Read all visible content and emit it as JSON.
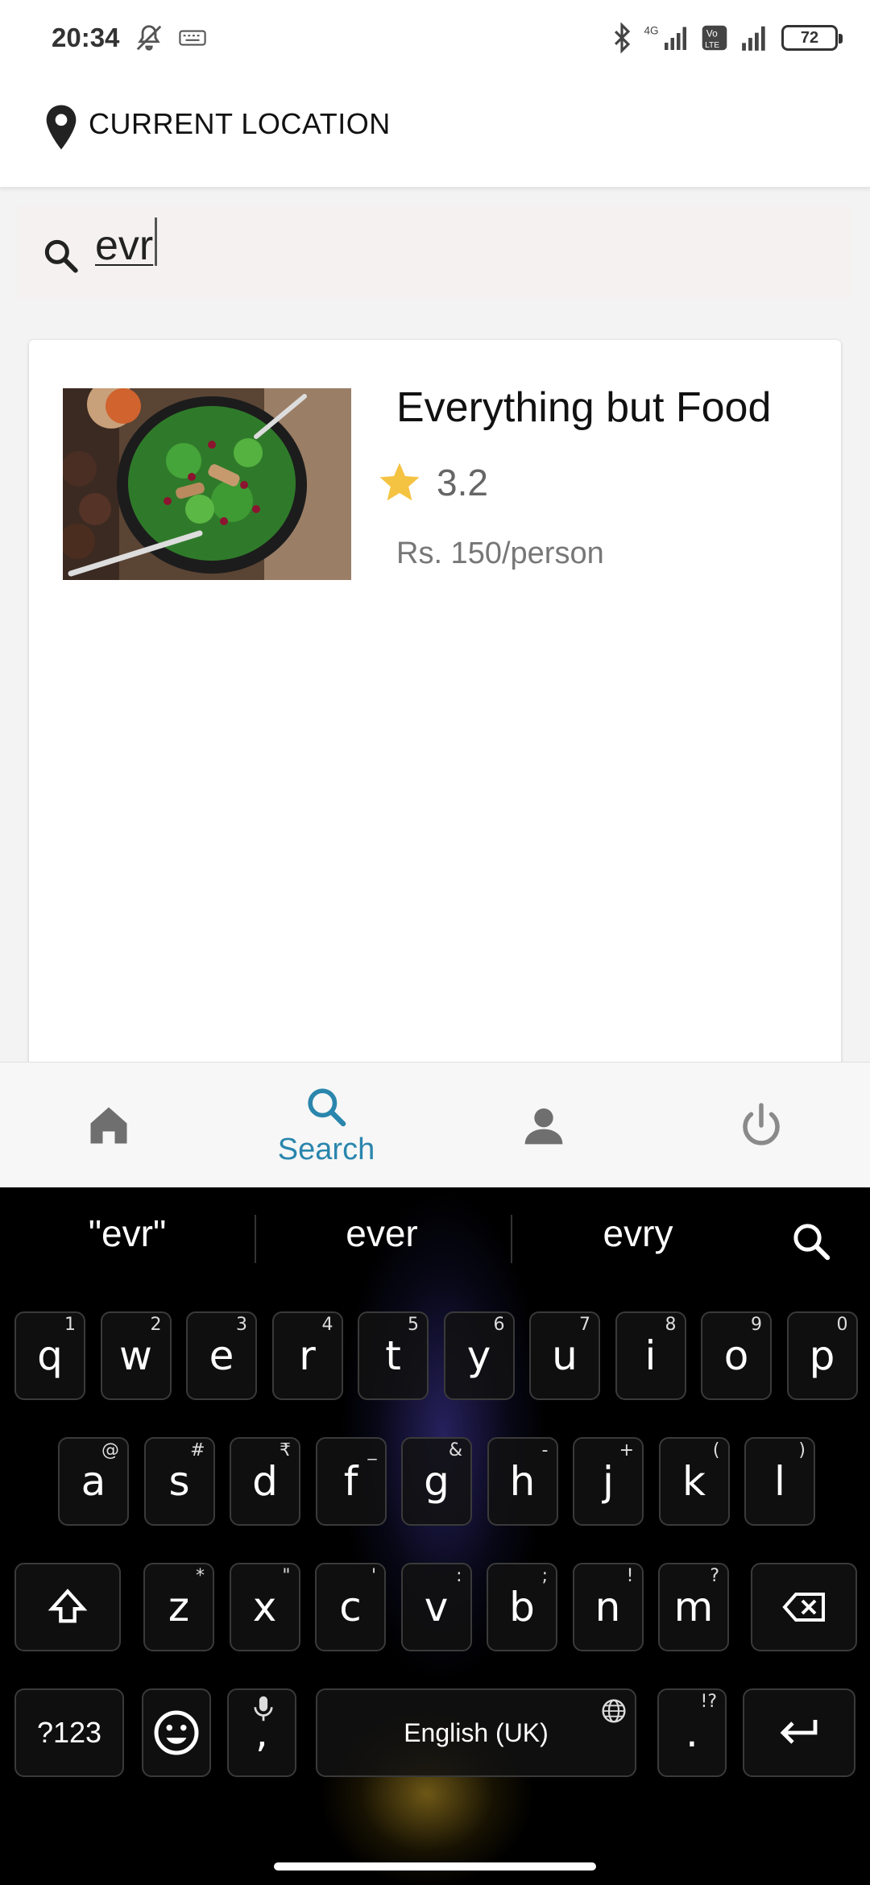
{
  "status_bar": {
    "time": "20:34",
    "battery": "72",
    "network_type": "4G",
    "volte": "Vo LTE"
  },
  "header": {
    "location_label": "CURRENT LOCATION"
  },
  "search": {
    "query": "evr"
  },
  "results": [
    {
      "name": "Everything but Food",
      "rating": "3.2",
      "price": "Rs. 150/person"
    }
  ],
  "bottom_nav": {
    "active_label": "Search"
  },
  "keyboard": {
    "suggestions": [
      "\"evr\"",
      "ever",
      "evry"
    ],
    "row1": [
      {
        "key": "q",
        "hint": "1"
      },
      {
        "key": "w",
        "hint": "2"
      },
      {
        "key": "e",
        "hint": "3"
      },
      {
        "key": "r",
        "hint": "4"
      },
      {
        "key": "t",
        "hint": "5"
      },
      {
        "key": "y",
        "hint": "6"
      },
      {
        "key": "u",
        "hint": "7"
      },
      {
        "key": "i",
        "hint": "8"
      },
      {
        "key": "o",
        "hint": "9"
      },
      {
        "key": "p",
        "hint": "0"
      }
    ],
    "row2": [
      {
        "key": "a",
        "hint": "@"
      },
      {
        "key": "s",
        "hint": "#"
      },
      {
        "key": "d",
        "hint": "₹"
      },
      {
        "key": "f",
        "hint": "_"
      },
      {
        "key": "g",
        "hint": "&"
      },
      {
        "key": "h",
        "hint": "-"
      },
      {
        "key": "j",
        "hint": "+"
      },
      {
        "key": "k",
        "hint": "("
      },
      {
        "key": "l",
        "hint": ")"
      }
    ],
    "row3": [
      {
        "key": "z",
        "hint": "*"
      },
      {
        "key": "x",
        "hint": "\""
      },
      {
        "key": "c",
        "hint": "'"
      },
      {
        "key": "v",
        "hint": ":"
      },
      {
        "key": "b",
        "hint": ";"
      },
      {
        "key": "n",
        "hint": "!"
      },
      {
        "key": "m",
        "hint": "?"
      }
    ],
    "symbols_label": "?123",
    "comma": ",",
    "space_label": "English (UK)",
    "period": ".",
    "period_hint": "!?"
  },
  "colors": {
    "accent": "#2a86ad",
    "star": "#f5c342"
  }
}
